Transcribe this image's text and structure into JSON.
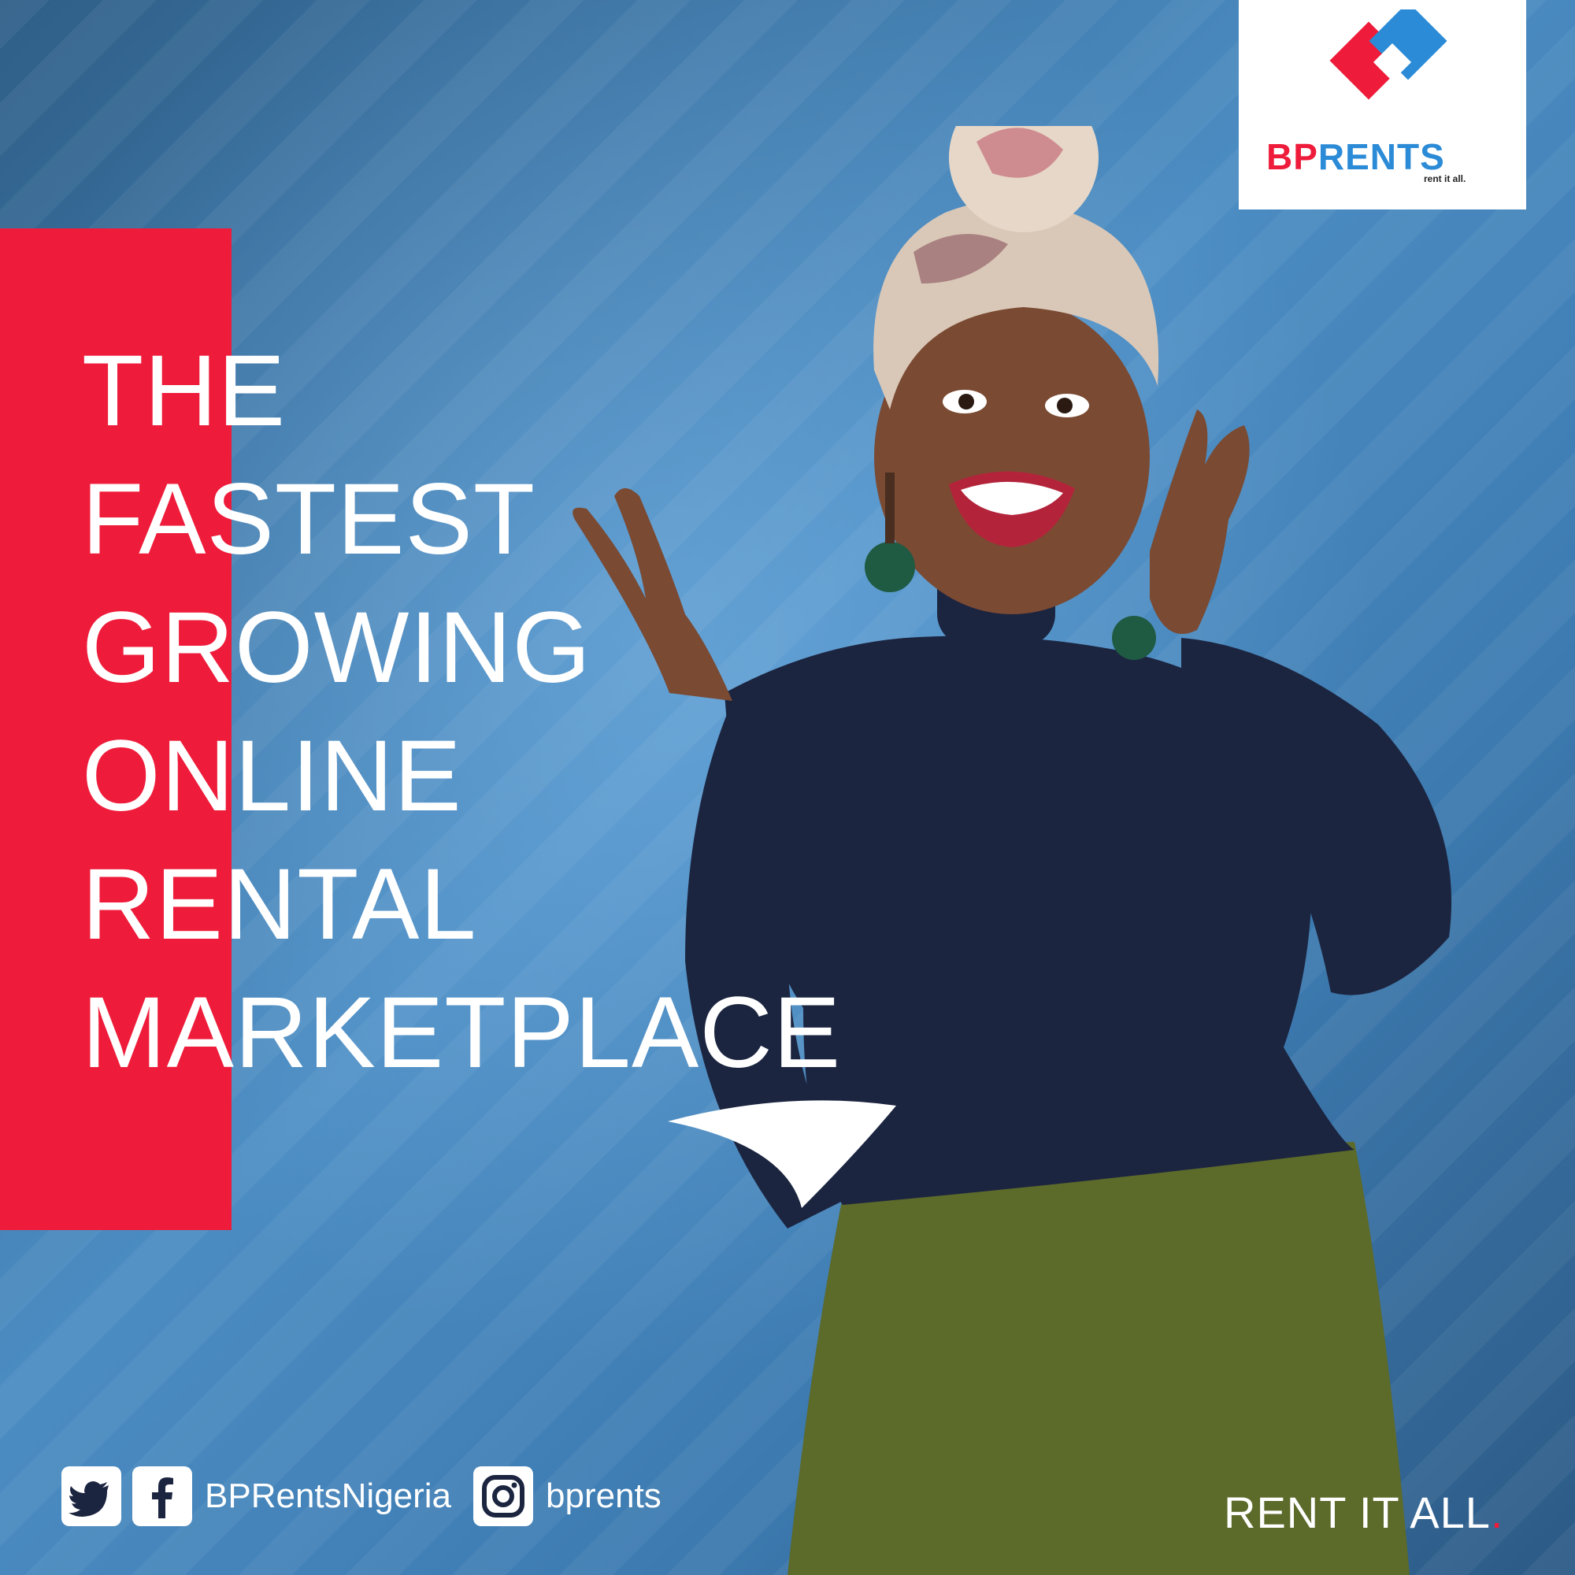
{
  "brand": {
    "name_part1": "BP",
    "name_part2": "RENTS",
    "tagline_small": "rent it all.",
    "red": "#ee1c3a",
    "blue": "#2c8bd6"
  },
  "headline": {
    "lines": [
      "THE",
      "FASTEST",
      "GROWING",
      "ONLINE",
      "RENTAL",
      "MARKETPLACE"
    ]
  },
  "social": {
    "icons": [
      "twitter-icon",
      "facebook-icon",
      "instagram-icon"
    ],
    "handle_primary": "BPRentsNigeria",
    "handle_instagram": "bprents"
  },
  "footer": {
    "tagline": "RENT IT ALL",
    "tagline_dot": "."
  }
}
